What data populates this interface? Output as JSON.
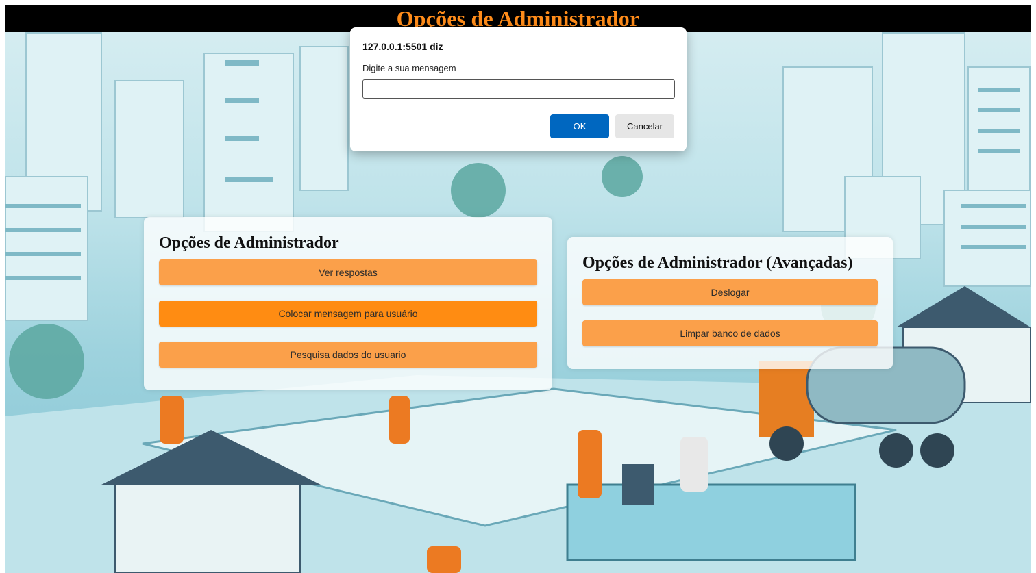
{
  "header": {
    "title": "Opções de Administrador"
  },
  "panels": {
    "basic": {
      "title": "Opções de Administrador",
      "buttons": [
        "Ver respostas",
        "Colocar mensagem para usuário",
        "Pesquisa dados do usuario"
      ]
    },
    "advanced": {
      "title": "Opções de Administrador (Avançadas)",
      "buttons": [
        "Deslogar",
        "Limpar banco de dados"
      ]
    }
  },
  "dialog": {
    "title": "127.0.0.1:5501 diz",
    "message": "Digite a sua mensagem",
    "input_value": "",
    "ok_label": "OK",
    "cancel_label": "Cancelar"
  },
  "colors": {
    "header_bg": "#000000",
    "header_text": "#ff8c1a",
    "button": "#fba04a",
    "button_active": "#ff8c12",
    "dialog_ok": "#0067c0"
  }
}
